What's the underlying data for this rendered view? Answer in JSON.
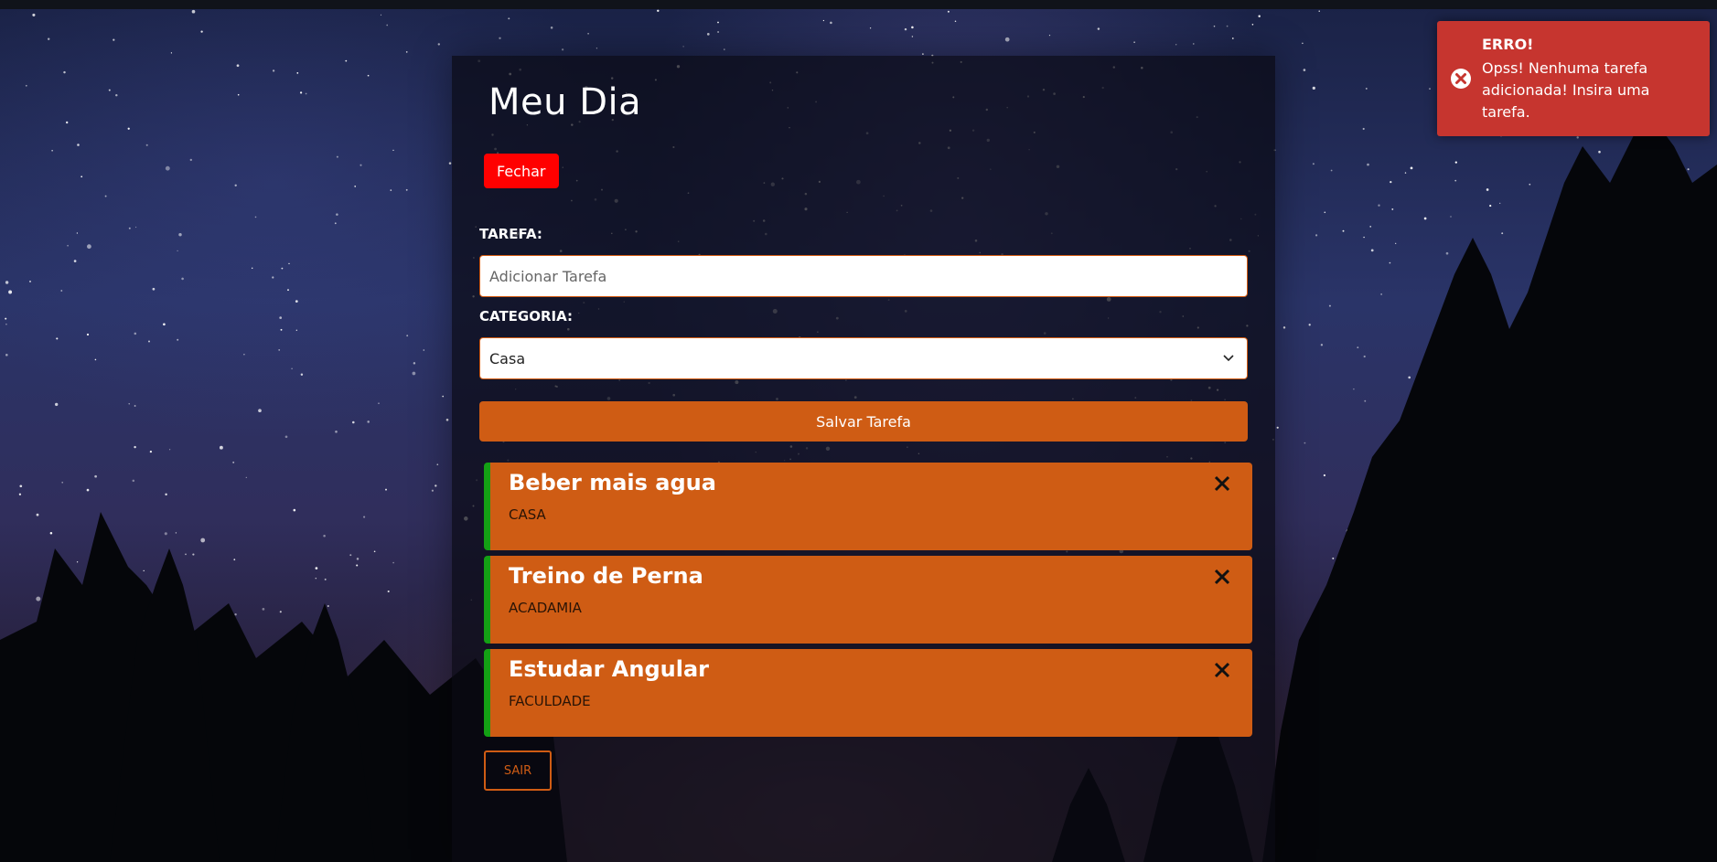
{
  "app": {
    "title": "Meu Dia",
    "close_button": "Fechar",
    "logout_button": "SAIR"
  },
  "form": {
    "task_label": "TAREFA:",
    "task_placeholder": "Adicionar Tarefa",
    "task_value": "",
    "category_label": "CATEGORIA:",
    "category_selected": "Casa",
    "save_button": "Salvar Tarefa"
  },
  "tasks": [
    {
      "title": "Beber mais agua",
      "category": "CASA"
    },
    {
      "title": "Treino de Perna",
      "category": "ACADAMIA"
    },
    {
      "title": "Estudar Angular",
      "category": "FACULDADE"
    }
  ],
  "toast": {
    "title": "ERRO!",
    "message": "Opss! Nenhuma tarefa adicionada! Insira uma tarefa."
  },
  "colors": {
    "accent": "#cf5c14",
    "close_button": "#ff0000",
    "task_border": "#14a014",
    "toast_bg": "#c6352f"
  },
  "icons": {
    "task_delete": "close-x-icon",
    "toast": "error-circle-icon",
    "select": "chevron-down-icon"
  }
}
